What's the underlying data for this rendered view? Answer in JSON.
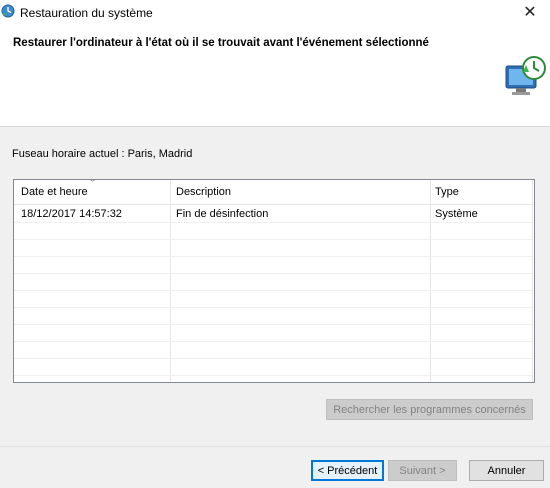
{
  "window": {
    "title": "Restauration du système",
    "close_glyph": "✕"
  },
  "header": {
    "heading": "Restaurer l'ordinateur à l'état où il se trouvait avant l'événement sélectionné",
    "icon": "system-restore-icon"
  },
  "timezone_label": "Fuseau horaire actuel : Paris, Madrid",
  "table": {
    "columns": [
      "Date et heure",
      "Description",
      "Type"
    ],
    "sort_column": "Date et heure",
    "rows": [
      {
        "date": "18/12/2017 14:57:32",
        "description": "Fin de désinfection",
        "type": "Système"
      }
    ]
  },
  "buttons": {
    "scan": "Rechercher les programmes concernés",
    "previous": "< Précédent",
    "next": "Suivant >",
    "cancel": "Annuler"
  },
  "colors": {
    "accent": "#0078d7",
    "window_bg": "#f0f0f0",
    "header_bg": "#ffffff"
  }
}
